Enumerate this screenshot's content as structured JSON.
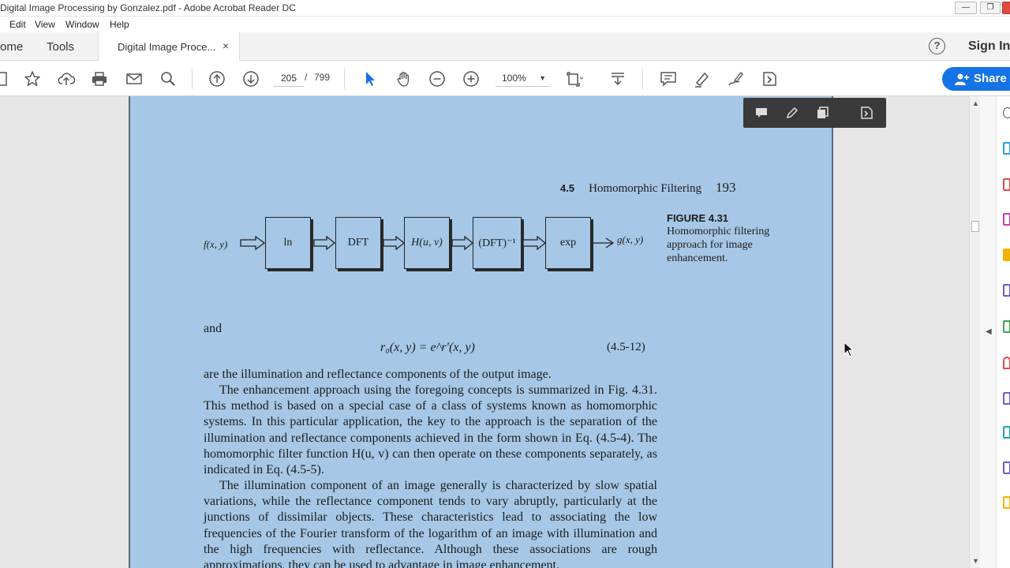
{
  "window": {
    "title": "Digital Image Processing by Gonzalez.pdf - Adobe Acrobat Reader DC",
    "controls": [
      "minimize",
      "restore",
      "close"
    ]
  },
  "menu": {
    "items": [
      "Edit",
      "View",
      "Window",
      "Help"
    ]
  },
  "tabs": {
    "home": "ome",
    "tools": "Tools",
    "document": "Digital Image Proce...",
    "close_symbol": "×",
    "help_symbol": "?",
    "sign_in": "Sign In"
  },
  "toolbar": {
    "icons": [
      "bookmark-icon",
      "star-icon",
      "upload-icon",
      "print-icon",
      "mail-icon",
      "search-icon",
      "page-up-icon",
      "page-down-icon",
      "select-cursor-icon",
      "hand-icon",
      "zoom-out-icon",
      "zoom-in-icon",
      "fit-page-icon",
      "scroll-mode-icon",
      "comment-icon",
      "highlight-icon",
      "sign-icon",
      "more-tools-icon"
    ],
    "current_page": "205",
    "page_separator": "/",
    "total_pages": "799",
    "zoom": "100%",
    "share_label": "Share",
    "accent_color": "#1473e6"
  },
  "floating_toolbar": {
    "icons": [
      "comment-icon",
      "pen-icon",
      "copy-icon",
      "more-tools-icon"
    ]
  },
  "page": {
    "background_color": "#a6c8e6",
    "section": "4.5",
    "section_title": "Homomorphic Filtering",
    "page_number": "193",
    "figure": {
      "number": "FIGURE 4.31",
      "caption": "Homomorphic filtering approach for image enhancement.",
      "input": "f(x, y)",
      "output": "g(x, y)",
      "blocks": [
        "ln",
        "DFT",
        "H(u, v)",
        "(DFT)⁻¹",
        "exp"
      ]
    },
    "and": "and",
    "equation": "r₀(x, y) = e^r′(x, y)",
    "equation_number": "(4.5-12)",
    "paragraphs": [
      "are the illumination and reflectance components of the output image.",
      "The enhancement approach using the foregoing concepts is summarized in Fig. 4.31. This method is based on a special case of a class of systems known as homomorphic systems. In this particular application, the key to the approach is the separation of the illumination and reflectance components achieved in the form shown in Eq. (4.5-4). The homomorphic filter function H(u, v) can then operate on these components separately, as indicated in Eq. (4.5-5).",
      "The illumination component of an image generally is characterized by slow spatial variations, while the reflectance component tends to vary abruptly, particularly at the junctions of dissimilar objects. These characteristics lead to associating the low frequencies of the Fourier transform of the logarithm of an image with illumination and the high frequencies with reflectance. Although these associations are rough approximations, they can be used to advantage in image enhancement."
    ]
  }
}
